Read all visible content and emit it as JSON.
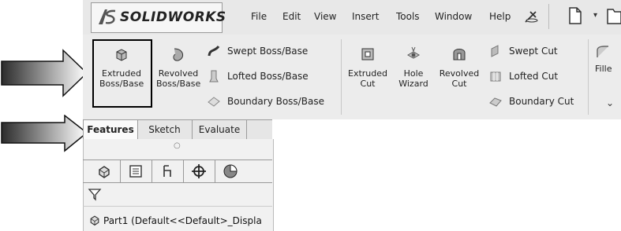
{
  "app": {
    "logo_text": "SOLIDWORKS"
  },
  "menu": [
    "File",
    "Edit",
    "View",
    "Insert",
    "Tools",
    "Window",
    "Help"
  ],
  "ribbon": {
    "extruded_boss": [
      "Extruded",
      "Boss/Base"
    ],
    "revolved_boss": [
      "Revolved",
      "Boss/Base"
    ],
    "swept_boss": "Swept Boss/Base",
    "lofted_boss": "Lofted Boss/Base",
    "boundary_boss": "Boundary Boss/Base",
    "extruded_cut": [
      "Extruded",
      "Cut"
    ],
    "hole_wizard": [
      "Hole",
      "Wizard"
    ],
    "revolved_cut": [
      "Revolved",
      "Cut"
    ],
    "swept_cut": "Swept Cut",
    "lofted_cut": "Lofted Cut",
    "boundary_cut": "Boundary Cut",
    "fillet": "Fille",
    "expander": "⌄"
  },
  "tabs": [
    "Features",
    "Sketch",
    "Evaluate"
  ],
  "panel": {
    "collapse_glyph": "○",
    "tree_item": "Part1  (Default<<Default>_Displa"
  },
  "colors": {
    "highlight_box": "#000000",
    "arrow_dark": "#2b2b2b"
  }
}
